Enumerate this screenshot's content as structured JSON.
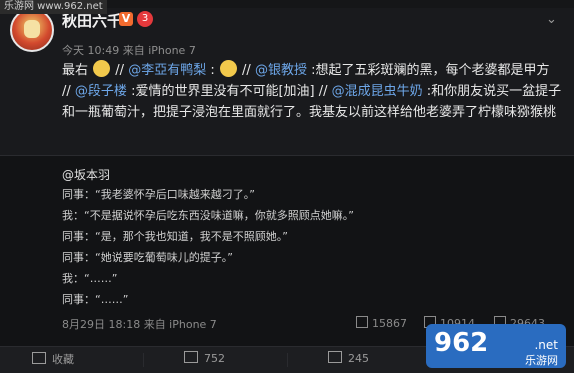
{
  "watermark": {
    "top_left": "乐游网 www.962.net"
  },
  "post": {
    "user": "秋田六千",
    "badge_v": "V",
    "badge_red": "3",
    "time": "今天 10:49 来自 iPhone 7",
    "text_parts": [
      "最右",
      "//",
      "@李亞有鸭梨",
      ":",
      "//",
      "@银教授",
      ":想起了五彩斑斓的黑，每个老婆都是甲方",
      "//",
      "@段子楼",
      ":爱情的世界里没有不可能[加油]",
      "//",
      "@混成昆虫牛奶",
      ":和你朋友说买一盆提子和一瓶葡萄汁，把提子浸泡在里面就行了。我基友以前这样给他老婆弄了柠檬味猕猴桃"
    ]
  },
  "quote": {
    "author": "@坂本羽",
    "lines": [
      "同事：“我老婆怀孕后口味越来越刁了。”",
      "我：“不是据说怀孕后吃东西没味道嘛，你就多照顾点她嘛。”",
      "同事：“是，那个我也知道，我不是不照顾她。”",
      "同事：“她说要吃葡萄味儿的提子。”",
      "我：“……”",
      "同事：“……”"
    ],
    "meta": "8月29日 18:18 来自 iPhone 7",
    "stats": {
      "reposts": "15867",
      "comments": "10914",
      "likes": "29643"
    }
  },
  "actions": {
    "favorite": "收藏",
    "repost": "752",
    "comment": "245",
    "like": ""
  },
  "logo": {
    "number": "962",
    "domain": ".net",
    "sub": "乐游网"
  }
}
